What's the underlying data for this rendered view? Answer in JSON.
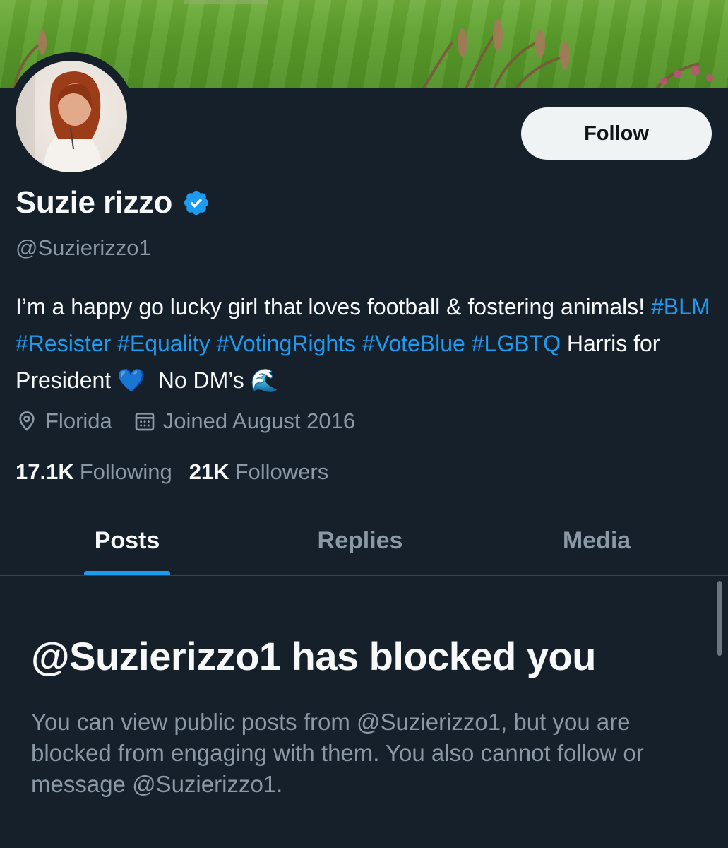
{
  "profile": {
    "name": "Suzie rizzo",
    "handle": "@Suzierizzo1",
    "verified": true,
    "follow_label": "Follow",
    "bio": {
      "text1": "I’m a happy go lucky girl that loves football & fostering animals! ",
      "tags1": [
        "#BLM",
        "#Resister",
        "#Equality",
        "#VotingRights",
        "#VoteBlue",
        "#LGBTQ"
      ],
      "text2": " Harris for President ",
      "heart": "💙",
      "text3": "  No DM’s ",
      "wave": "🌊"
    },
    "location": "Florida",
    "joined": "Joined August 2016",
    "following_count": "17.1K",
    "following_label": "Following",
    "followers_count": "21K",
    "followers_label": "Followers"
  },
  "tabs": [
    {
      "label": "Posts",
      "active": true
    },
    {
      "label": "Replies",
      "active": false
    },
    {
      "label": "Media",
      "active": false
    }
  ],
  "blocked": {
    "title": "@Suzierizzo1 has blocked you",
    "description": "You can view public posts from @Suzierizzo1, but you are blocked from engaging with them. You also cannot follow or message @Suzierizzo1."
  },
  "colors": {
    "background": "#15202b",
    "accent": "#1d9bf0",
    "muted": "#8b98a5"
  }
}
